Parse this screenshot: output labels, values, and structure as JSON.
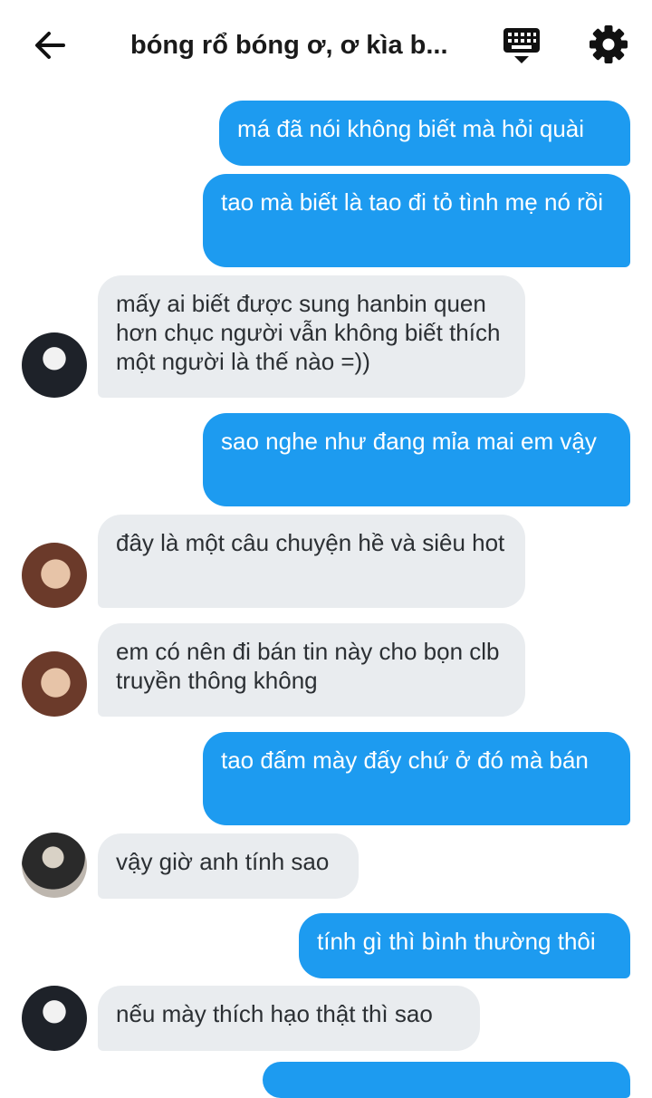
{
  "header": {
    "title": "bóng rổ bóng ơ, ơ kìa b...",
    "icons": {
      "back": "arrow-left-icon",
      "keyboard": "keyboard-icon",
      "settings": "gear-icon"
    }
  },
  "colors": {
    "outgoing": "#1d9bf0",
    "incoming": "#e9ecef"
  },
  "messages": [
    {
      "side": "out",
      "text": "má đã nói không biết mà hỏi quài"
    },
    {
      "side": "out",
      "text": "tao mà biết là tao đi tỏ tình mẹ nó rồi"
    },
    {
      "side": "in",
      "text": "mấy ai biết được sung hanbin quen hơn chục người vẫn không biết thích một người là thế nào =))"
    },
    {
      "side": "out",
      "text": "sao nghe như đang mỉa mai em vậy"
    },
    {
      "side": "in",
      "text": "đây là một câu chuyện hề và siêu hot"
    },
    {
      "side": "in",
      "text": "em có nên đi bán tin này cho bọn clb truyền thông không"
    },
    {
      "side": "out",
      "text": "tao đấm mày đấy chứ ở đó mà bán"
    },
    {
      "side": "in",
      "text": "vậy giờ anh tính sao"
    },
    {
      "side": "out",
      "text": "tính gì thì bình thường thôi"
    },
    {
      "side": "in",
      "text": "nếu mày thích hạo thật thì sao"
    }
  ]
}
